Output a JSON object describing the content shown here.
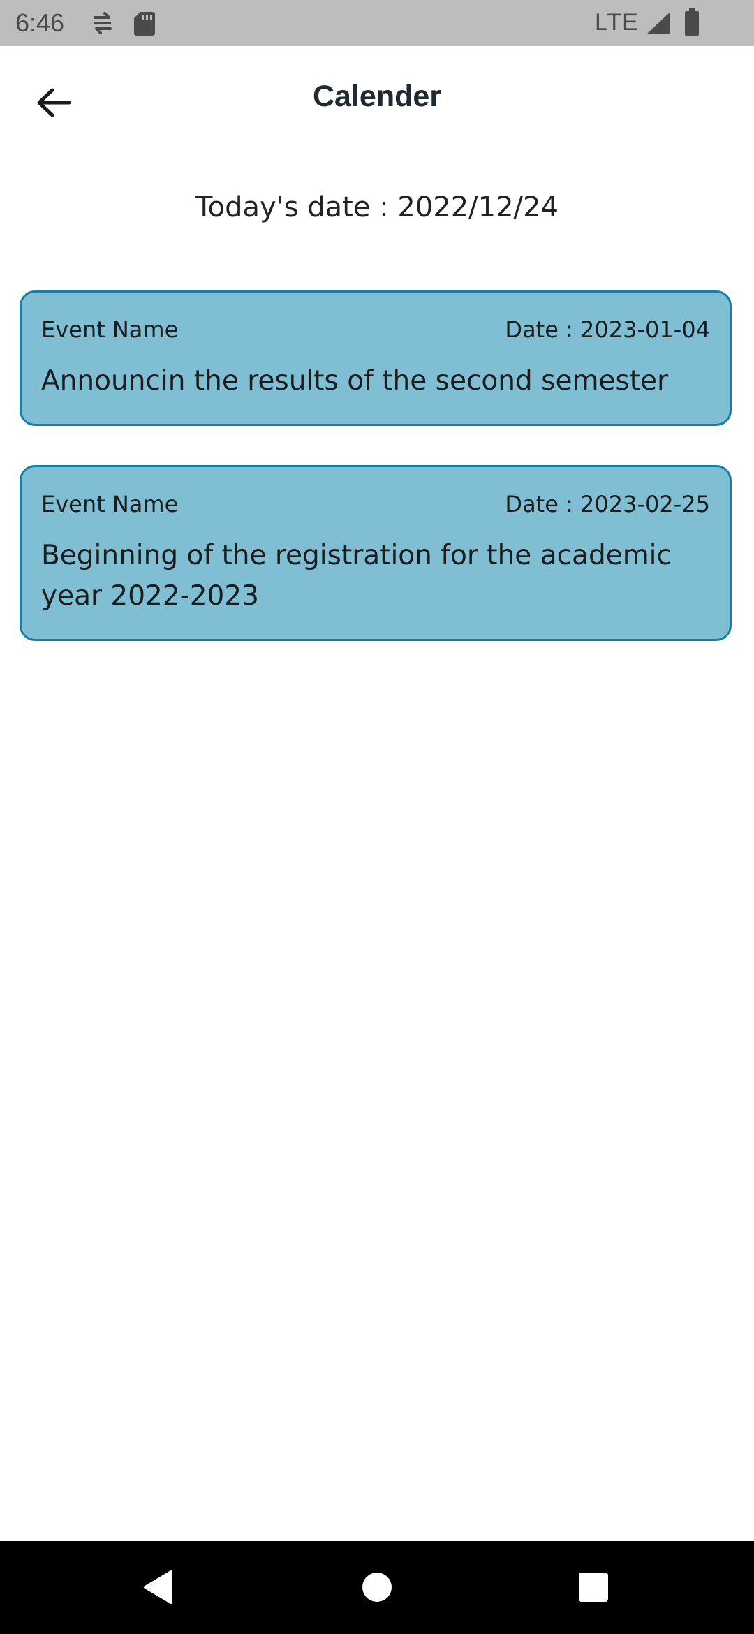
{
  "status_bar": {
    "time": "6:46",
    "network": "LTE",
    "icons": [
      "sync-icon",
      "sd-card-icon",
      "signal-icon",
      "battery-icon"
    ]
  },
  "app_bar": {
    "title": "Calender",
    "back_icon": "arrow-left-icon"
  },
  "today": {
    "label": "Today's date : 2022/12/24"
  },
  "events": [
    {
      "label": "Event Name",
      "date": "Date : 2023-01-04",
      "description": "Announcin the results of the second semester"
    },
    {
      "label": "Event Name",
      "date": "Date : 2023-02-25",
      "description": "Beginning of the registration for the academic year 2022-2023"
    }
  ],
  "nav_bar": {
    "icons": [
      "back-triangle-icon",
      "home-circle-icon",
      "recents-square-icon"
    ]
  },
  "colors": {
    "status_bar": "#bdbdbd",
    "card_fill": "#80bed4",
    "card_border": "#177ea6",
    "nav_bar": "#000000"
  }
}
